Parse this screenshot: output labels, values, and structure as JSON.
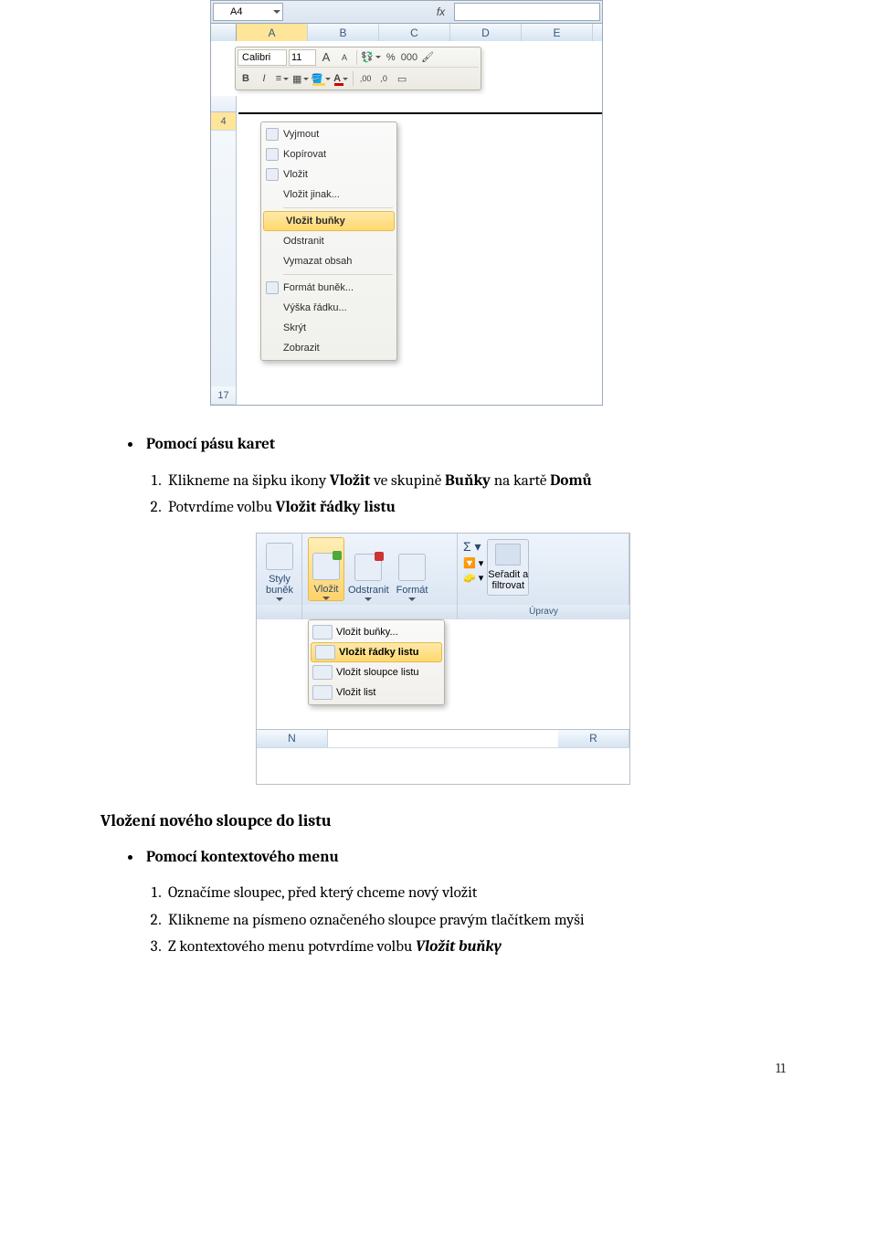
{
  "shot1": {
    "namebox": "A4",
    "columns": [
      "A",
      "B",
      "C",
      "D",
      "E"
    ],
    "fontName": "Calibri",
    "fontSize": "11",
    "bigA": "A",
    "smallA": "A",
    "percent": "%",
    "thousands": "000",
    "bold": "B",
    "italic": "I",
    "decInc": ",00",
    "decDec": ",0",
    "rowSelected": "4",
    "rowLast": "17",
    "context": {
      "cut": "Vyjmout",
      "copy": "Kopírovat",
      "paste": "Vložit",
      "pasteSpecial": "Vložit jinak...",
      "insertCells": "Vložit buňky",
      "delete": "Odstranit",
      "clear": "Vymazat obsah",
      "formatCells": "Formát buněk...",
      "rowHeight": "Výška řádku...",
      "hide": "Skrýt",
      "unhide": "Zobrazit"
    }
  },
  "text": {
    "h1": "Pomocí pásu karet",
    "step1a": "Klikneme na šipku ikony ",
    "step1b": "Vložit",
    "step1c": " ve skupině ",
    "step1d": "Buňky",
    "step1e": " na kartě ",
    "step1f": "Domů",
    "step2a": "Potvrdíme volbu ",
    "step2b": "Vložit řádky listu",
    "h2": "Vložení nového sloupce do listu",
    "h3": "Pomocí kontextového menu",
    "s1": "Označíme sloupec, před který chceme nový vložit",
    "s2": "Klikneme na písmeno označeného sloupce pravým tlačítkem myši",
    "s3a": "Z kontextového menu potvrdíme volbu ",
    "s3b": "Vložit buňky",
    "page": "11"
  },
  "shot2": {
    "styles": "Styly\nbuněk",
    "insert": "Vložit",
    "delete": "Odstranit",
    "format": "Formát",
    "sort": "Seřadit a\nfiltrovat",
    "groupEditing": "Úpravy",
    "colLeft": "N",
    "colRight": "R",
    "menu": {
      "cells": "Vložit buňky...",
      "rows": "Vložit řádky listu",
      "cols": "Vložit sloupce listu",
      "sheet": "Vložit list"
    }
  }
}
